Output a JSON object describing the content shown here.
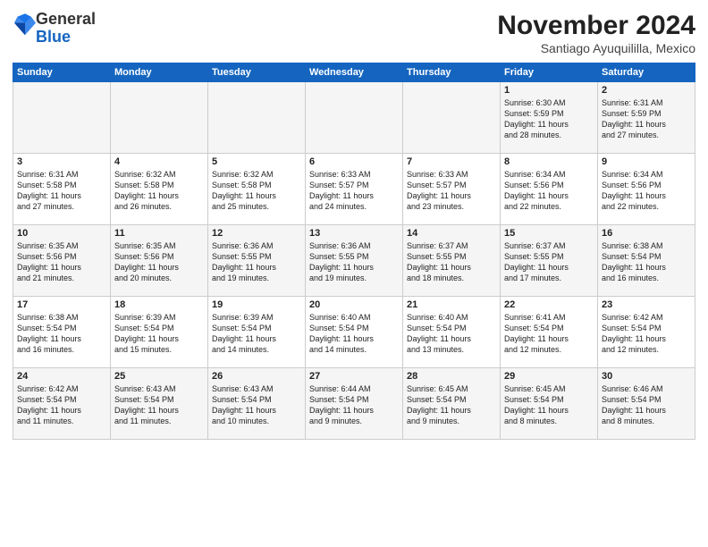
{
  "logo": {
    "general": "General",
    "blue": "Blue"
  },
  "title": "November 2024",
  "location": "Santiago Ayuquililla, Mexico",
  "weekdays": [
    "Sunday",
    "Monday",
    "Tuesday",
    "Wednesday",
    "Thursday",
    "Friday",
    "Saturday"
  ],
  "weeks": [
    [
      {
        "day": "",
        "info": ""
      },
      {
        "day": "",
        "info": ""
      },
      {
        "day": "",
        "info": ""
      },
      {
        "day": "",
        "info": ""
      },
      {
        "day": "",
        "info": ""
      },
      {
        "day": "1",
        "info": "Sunrise: 6:30 AM\nSunset: 5:59 PM\nDaylight: 11 hours\nand 28 minutes."
      },
      {
        "day": "2",
        "info": "Sunrise: 6:31 AM\nSunset: 5:59 PM\nDaylight: 11 hours\nand 27 minutes."
      }
    ],
    [
      {
        "day": "3",
        "info": "Sunrise: 6:31 AM\nSunset: 5:58 PM\nDaylight: 11 hours\nand 27 minutes."
      },
      {
        "day": "4",
        "info": "Sunrise: 6:32 AM\nSunset: 5:58 PM\nDaylight: 11 hours\nand 26 minutes."
      },
      {
        "day": "5",
        "info": "Sunrise: 6:32 AM\nSunset: 5:58 PM\nDaylight: 11 hours\nand 25 minutes."
      },
      {
        "day": "6",
        "info": "Sunrise: 6:33 AM\nSunset: 5:57 PM\nDaylight: 11 hours\nand 24 minutes."
      },
      {
        "day": "7",
        "info": "Sunrise: 6:33 AM\nSunset: 5:57 PM\nDaylight: 11 hours\nand 23 minutes."
      },
      {
        "day": "8",
        "info": "Sunrise: 6:34 AM\nSunset: 5:56 PM\nDaylight: 11 hours\nand 22 minutes."
      },
      {
        "day": "9",
        "info": "Sunrise: 6:34 AM\nSunset: 5:56 PM\nDaylight: 11 hours\nand 22 minutes."
      }
    ],
    [
      {
        "day": "10",
        "info": "Sunrise: 6:35 AM\nSunset: 5:56 PM\nDaylight: 11 hours\nand 21 minutes."
      },
      {
        "day": "11",
        "info": "Sunrise: 6:35 AM\nSunset: 5:56 PM\nDaylight: 11 hours\nand 20 minutes."
      },
      {
        "day": "12",
        "info": "Sunrise: 6:36 AM\nSunset: 5:55 PM\nDaylight: 11 hours\nand 19 minutes."
      },
      {
        "day": "13",
        "info": "Sunrise: 6:36 AM\nSunset: 5:55 PM\nDaylight: 11 hours\nand 19 minutes."
      },
      {
        "day": "14",
        "info": "Sunrise: 6:37 AM\nSunset: 5:55 PM\nDaylight: 11 hours\nand 18 minutes."
      },
      {
        "day": "15",
        "info": "Sunrise: 6:37 AM\nSunset: 5:55 PM\nDaylight: 11 hours\nand 17 minutes."
      },
      {
        "day": "16",
        "info": "Sunrise: 6:38 AM\nSunset: 5:54 PM\nDaylight: 11 hours\nand 16 minutes."
      }
    ],
    [
      {
        "day": "17",
        "info": "Sunrise: 6:38 AM\nSunset: 5:54 PM\nDaylight: 11 hours\nand 16 minutes."
      },
      {
        "day": "18",
        "info": "Sunrise: 6:39 AM\nSunset: 5:54 PM\nDaylight: 11 hours\nand 15 minutes."
      },
      {
        "day": "19",
        "info": "Sunrise: 6:39 AM\nSunset: 5:54 PM\nDaylight: 11 hours\nand 14 minutes."
      },
      {
        "day": "20",
        "info": "Sunrise: 6:40 AM\nSunset: 5:54 PM\nDaylight: 11 hours\nand 14 minutes."
      },
      {
        "day": "21",
        "info": "Sunrise: 6:40 AM\nSunset: 5:54 PM\nDaylight: 11 hours\nand 13 minutes."
      },
      {
        "day": "22",
        "info": "Sunrise: 6:41 AM\nSunset: 5:54 PM\nDaylight: 11 hours\nand 12 minutes."
      },
      {
        "day": "23",
        "info": "Sunrise: 6:42 AM\nSunset: 5:54 PM\nDaylight: 11 hours\nand 12 minutes."
      }
    ],
    [
      {
        "day": "24",
        "info": "Sunrise: 6:42 AM\nSunset: 5:54 PM\nDaylight: 11 hours\nand 11 minutes."
      },
      {
        "day": "25",
        "info": "Sunrise: 6:43 AM\nSunset: 5:54 PM\nDaylight: 11 hours\nand 11 minutes."
      },
      {
        "day": "26",
        "info": "Sunrise: 6:43 AM\nSunset: 5:54 PM\nDaylight: 11 hours\nand 10 minutes."
      },
      {
        "day": "27",
        "info": "Sunrise: 6:44 AM\nSunset: 5:54 PM\nDaylight: 11 hours\nand 9 minutes."
      },
      {
        "day": "28",
        "info": "Sunrise: 6:45 AM\nSunset: 5:54 PM\nDaylight: 11 hours\nand 9 minutes."
      },
      {
        "day": "29",
        "info": "Sunrise: 6:45 AM\nSunset: 5:54 PM\nDaylight: 11 hours\nand 8 minutes."
      },
      {
        "day": "30",
        "info": "Sunrise: 6:46 AM\nSunset: 5:54 PM\nDaylight: 11 hours\nand 8 minutes."
      }
    ]
  ]
}
